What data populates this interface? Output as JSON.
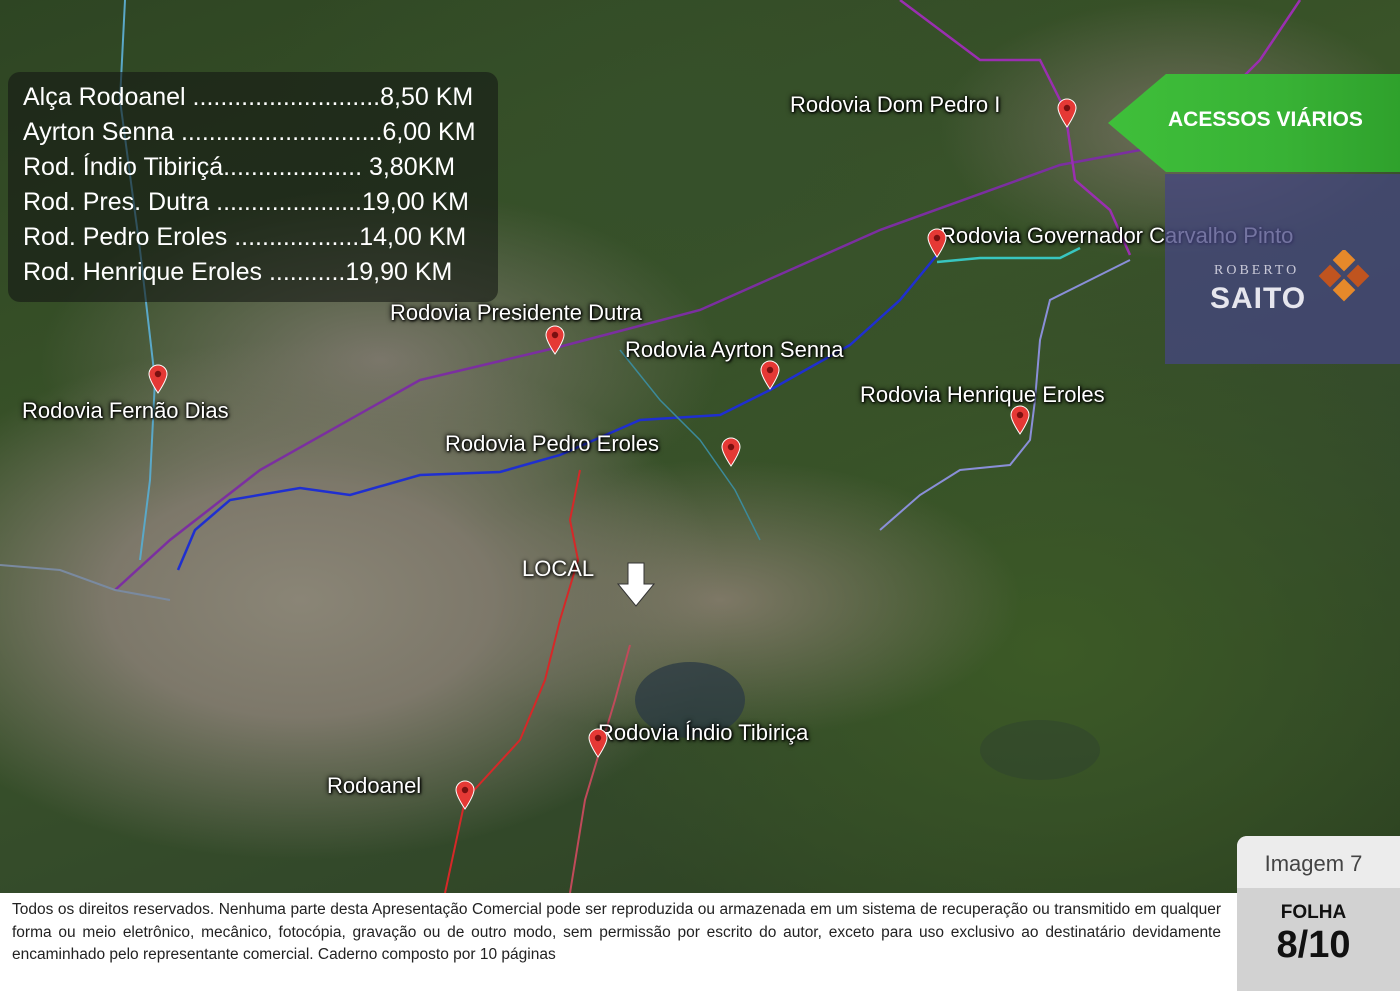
{
  "distances": [
    {
      "text": "Alça Rodoanel ...........................8,50 KM"
    },
    {
      "text": "Ayrton Senna .............................6,00 KM"
    },
    {
      "text": "Rod. Índio Tibiriçá.................... 3,80KM"
    },
    {
      "text": "Rod. Pres. Dutra .....................19,00 KM"
    },
    {
      "text": "Rod. Pedro Eroles ..................14,00 KM"
    },
    {
      "text": "Rod. Henrique Eroles ...........19,90 KM"
    }
  ],
  "map": {
    "labels": {
      "dom_pedro": "Rodovia Dom Pedro I",
      "carvalho_pinto": "Rodovia Governador Carvalho Pinto",
      "presidente_dutra": "Rodovia Presidente Dutra",
      "ayrton_senna": "Rodovia Ayrton Senna",
      "fernao_dias": "Rodovia Fernão Dias",
      "henrique_eroles": "Rodovia Henrique Eroles",
      "pedro_eroles": "Rodovia Pedro Eroles",
      "local": "LOCAL",
      "indio_tibirica": "Rodovia Índio Tibiriça",
      "rodoanel": "Rodoanel"
    },
    "pin_color": "#e53935",
    "route_colors": {
      "dutra": "#7b2fa0",
      "ayrton_senna": "#1f2fd0",
      "carvalho_pinto": "#38c6c0",
      "henrique_eroles": "#8a8fd8",
      "rodoanel": "#d62828",
      "indio_tibirica": "#c04a5a",
      "fernao_dias": "#5aa8c8",
      "dom_pedro": "#9a2fb0"
    }
  },
  "banner": {
    "title": "ACESSOS VIÁRIOS",
    "color": "#3fbf3a"
  },
  "logo": {
    "top_text": "ROBERTO",
    "main_text": "SAITO",
    "mark_colors": [
      "#e6892a",
      "#c0541f"
    ]
  },
  "footer": {
    "disclaimer": "Todos os direitos reservados. Nenhuma parte desta Apresentação Comercial pode ser reproduzida ou armazenada em um sistema de recuperação ou transmitido em qualquer forma ou meio eletrônico, mecânico, fotocópia, gravação ou de outro modo, sem permissão por escrito do autor, exceto para uso exclusivo ao destinatário devidamente encaminhado pelo representante comercial. Caderno composto por 10 páginas"
  },
  "sheet": {
    "image_label": "Imagem 7",
    "folha_label": "FOLHA",
    "page": "8/10"
  }
}
